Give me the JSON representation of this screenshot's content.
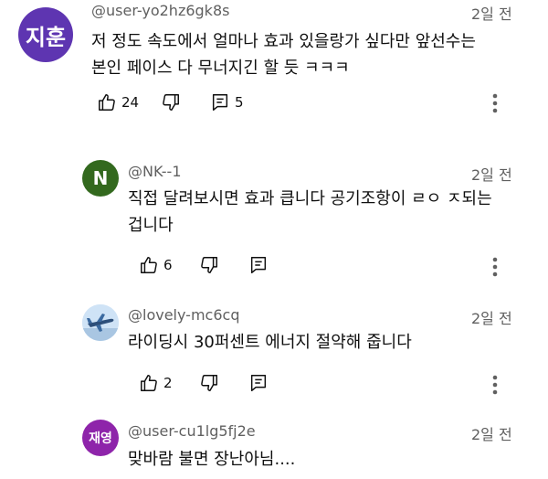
{
  "comments": [
    {
      "avatar_text": "지훈",
      "avatar_color": "#5e35b1",
      "handle": "@user-yo2hz6gk8s",
      "time": "2일 전",
      "lines": [
        "저 정도 속도에서 얼마나 효과 있을랑가 싶다만 앞선수는",
        "본인 페이스 다 무너지긴 할 듯 ㅋㅋㅋ"
      ],
      "likes": "24",
      "replies": "5"
    },
    {
      "avatar_text": "N",
      "avatar_color": "#33691e",
      "handle": "@NK--1",
      "time": "2일 전",
      "lines": [
        "직접 달려보시면 효과 큽니다 공기조항이 ㄹㅇ ㅈ되는",
        "겁니다"
      ],
      "likes": "6"
    },
    {
      "avatar_icon": "airplane-icon",
      "avatar_color": "#cfe3f6",
      "handle": "@lovely-mc6cq",
      "time": "2일 전",
      "lines": [
        "라이딩시 30퍼센트 에너지 절약해 줍니다"
      ],
      "likes": "2"
    },
    {
      "avatar_text": "재영",
      "avatar_color": "#8e24aa",
      "handle": "@user-cu1lg5fj2e",
      "time": "2일 전",
      "lines": [
        "맞바람 불면 장난아님...."
      ]
    }
  ]
}
